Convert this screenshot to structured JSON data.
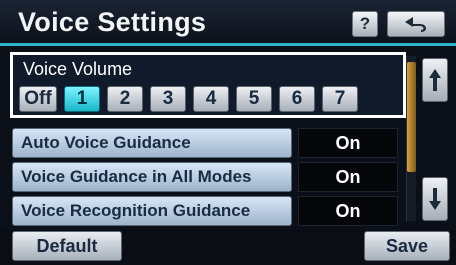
{
  "header": {
    "title": "Voice Settings",
    "help_label": "?",
    "back_icon": "back-arrow-icon"
  },
  "volume": {
    "label": "Voice Volume",
    "options": [
      "Off",
      "1",
      "2",
      "3",
      "4",
      "5",
      "6",
      "7"
    ],
    "selected": "1"
  },
  "settings": [
    {
      "label": "Auto Voice Guidance",
      "value": "On"
    },
    {
      "label": "Voice Guidance in All Modes",
      "value": "On"
    },
    {
      "label": "Voice Recognition Guidance",
      "value": "On"
    }
  ],
  "scroll": {
    "up_icon": "scroll-up-icon",
    "down_icon": "scroll-down-icon"
  },
  "bottom": {
    "default_label": "Default",
    "save_label": "Save"
  },
  "colors": {
    "accent": "#2bb6c8",
    "selected_button": "#1ab7c9",
    "scroll_thumb": "#d8a040"
  }
}
